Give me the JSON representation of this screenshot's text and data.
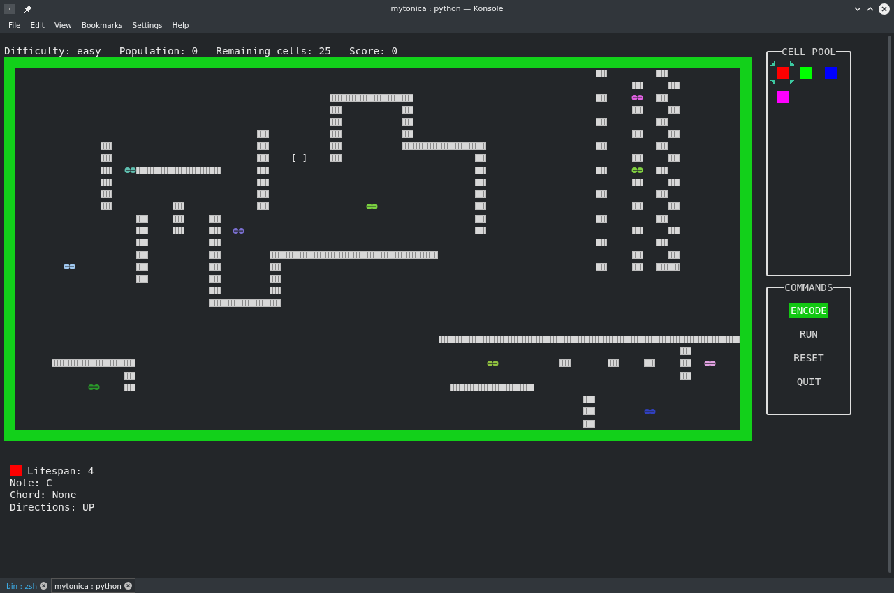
{
  "window": {
    "title": "mytonica : python — Konsole"
  },
  "menu": [
    "File",
    "Edit",
    "View",
    "Bookmarks",
    "Settings",
    "Help"
  ],
  "status": [
    "Difficulty: easy",
    "Population: 0",
    "Remaining cells: 25",
    "Score: 0"
  ],
  "board": {
    "cursor": "[ ]",
    "creatures": [
      {
        "color": "#5fbfb0"
      },
      {
        "color": "#7a6fd0"
      },
      {
        "color": "#7ad040"
      },
      {
        "color": "#a0c8f0"
      },
      {
        "color": "#e060e0"
      },
      {
        "color": "#80d040"
      },
      {
        "color": "#90c040"
      },
      {
        "color": "#e0a0e0"
      },
      {
        "color": "#2a9a2a"
      },
      {
        "color": "#3040c0"
      }
    ]
  },
  "cell_pool": {
    "title": "CELL POOL",
    "cells": [
      {
        "color": "#ff0000",
        "selected": true
      },
      {
        "color": "#00ff00",
        "selected": false
      },
      {
        "color": "#0000ff",
        "selected": false
      },
      {
        "color": "#ff00ff",
        "selected": false
      }
    ]
  },
  "commands": {
    "title": "COMMANDS",
    "items": [
      {
        "label": "ENCODE",
        "selected": true
      },
      {
        "label": "RUN",
        "selected": false
      },
      {
        "label": "RESET",
        "selected": false
      },
      {
        "label": "QUIT",
        "selected": false
      }
    ]
  },
  "info": {
    "color": "#ff0000",
    "lines": [
      "Lifespan: 4",
      "Note: C",
      "Chord: None",
      "Directions: UP"
    ]
  },
  "tabs": [
    {
      "label": "bin : zsh",
      "selected": false
    },
    {
      "label": "mytonica : python",
      "selected": true
    }
  ]
}
